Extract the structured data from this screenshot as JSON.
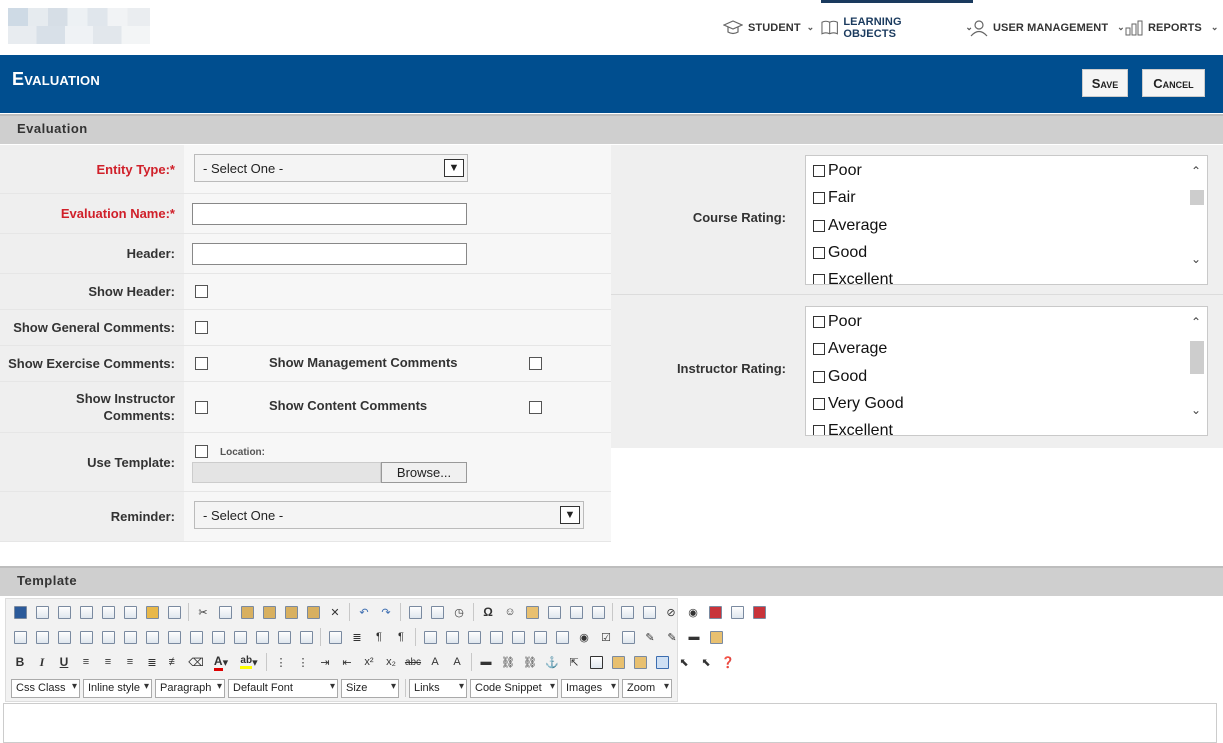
{
  "nav": {
    "student": "STUDENT",
    "learning_objects": "LEARNING OBJECTS",
    "user_management": "USER MANAGEMENT",
    "reports": "REPORTS"
  },
  "header": {
    "title": "Evaluation",
    "save": "Save",
    "cancel": "Cancel"
  },
  "section_evaluation": "Evaluation",
  "form": {
    "entity_type_label": "Entity Type:*",
    "entity_type_value": "- Select One -",
    "evaluation_name_label": "Evaluation Name:*",
    "evaluation_name_value": "",
    "header_label": "Header:",
    "header_value": "",
    "show_header_label": "Show Header:",
    "show_general_comments_label": "Show General Comments:",
    "show_exercise_comments_label": "Show Exercise Comments:",
    "show_management_comments_label": "Show Management Comments",
    "show_instructor_comments_label": "Show Instructor Comments:",
    "show_content_comments_label": "Show Content Comments",
    "use_template_label": "Use Template:",
    "location_label": "Location:",
    "browse_button": "Browse...",
    "reminder_label": "Reminder:",
    "reminder_value": "- Select One -"
  },
  "course_rating": {
    "label": "Course Rating:",
    "options": [
      "Poor",
      "Fair",
      "Average",
      "Good",
      "Excellent"
    ]
  },
  "instructor_rating": {
    "label": "Instructor Rating:",
    "options": [
      "Poor",
      "Average",
      "Good",
      "Very Good",
      "Excellent"
    ]
  },
  "section_template": "Template",
  "toolbar": {
    "dropdowns": [
      "Css Class",
      "Inline style",
      "Paragraph",
      "Default Font",
      "Size",
      "Links",
      "Code Snippet",
      "Images",
      "Zoom"
    ],
    "bold": "B",
    "italic": "I",
    "underline": "U"
  },
  "colors": {
    "brand": "#004e8f",
    "required": "#d0202a"
  }
}
